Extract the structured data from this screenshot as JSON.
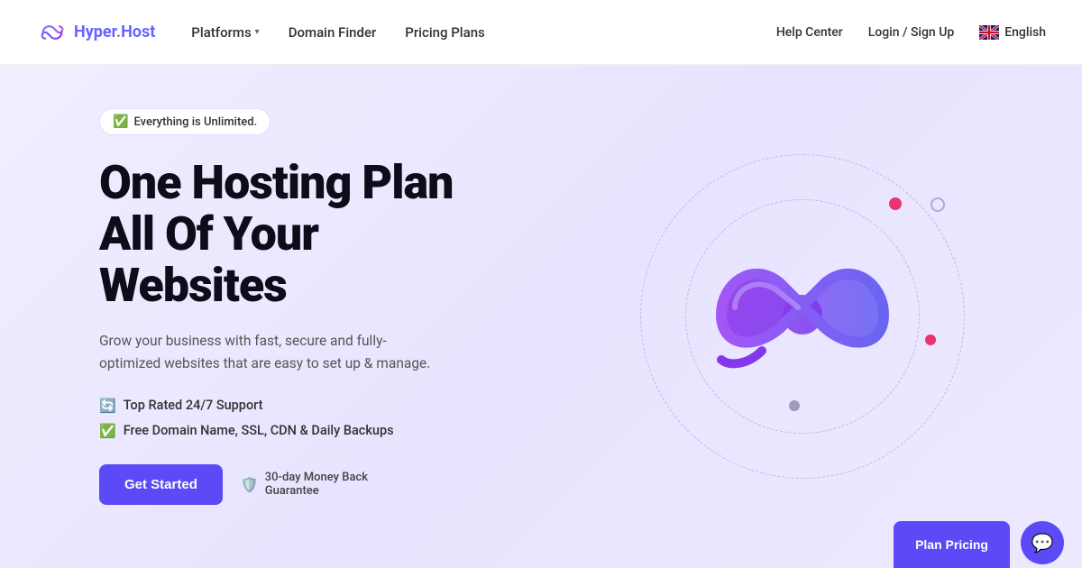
{
  "navbar": {
    "logo_text": "Hyper",
    "logo_dot": ".",
    "logo_host": "Host",
    "nav_items": [
      {
        "label": "Platforms",
        "has_dropdown": true
      },
      {
        "label": "Domain Finder",
        "has_dropdown": false
      },
      {
        "label": "Pricing Plans",
        "has_dropdown": false
      }
    ],
    "right_links": [
      {
        "label": "Help Center"
      },
      {
        "label": "Login / Sign Up"
      }
    ],
    "language": "English"
  },
  "hero": {
    "badge_text": "Everything is Unlimited.",
    "title_line1": "One Hosting Plan",
    "title_line2": "All Of Your",
    "title_line3": "Websites",
    "description": "Grow your business with fast, secure and fully-optimized websites that are easy to set up & manage.",
    "features": [
      {
        "icon": "🔄",
        "text": "Top Rated 24/7 Support"
      },
      {
        "icon": "✅",
        "text": "Free Domain Name, SSL, CDN & Daily Backups"
      }
    ],
    "cta_button": "Get Started",
    "money_back_text": "30-day Money Back",
    "money_back_sub": "Guarantee"
  },
  "bottom_buttons": {
    "label": "Plan Pricing",
    "chat_icon": "💬"
  }
}
